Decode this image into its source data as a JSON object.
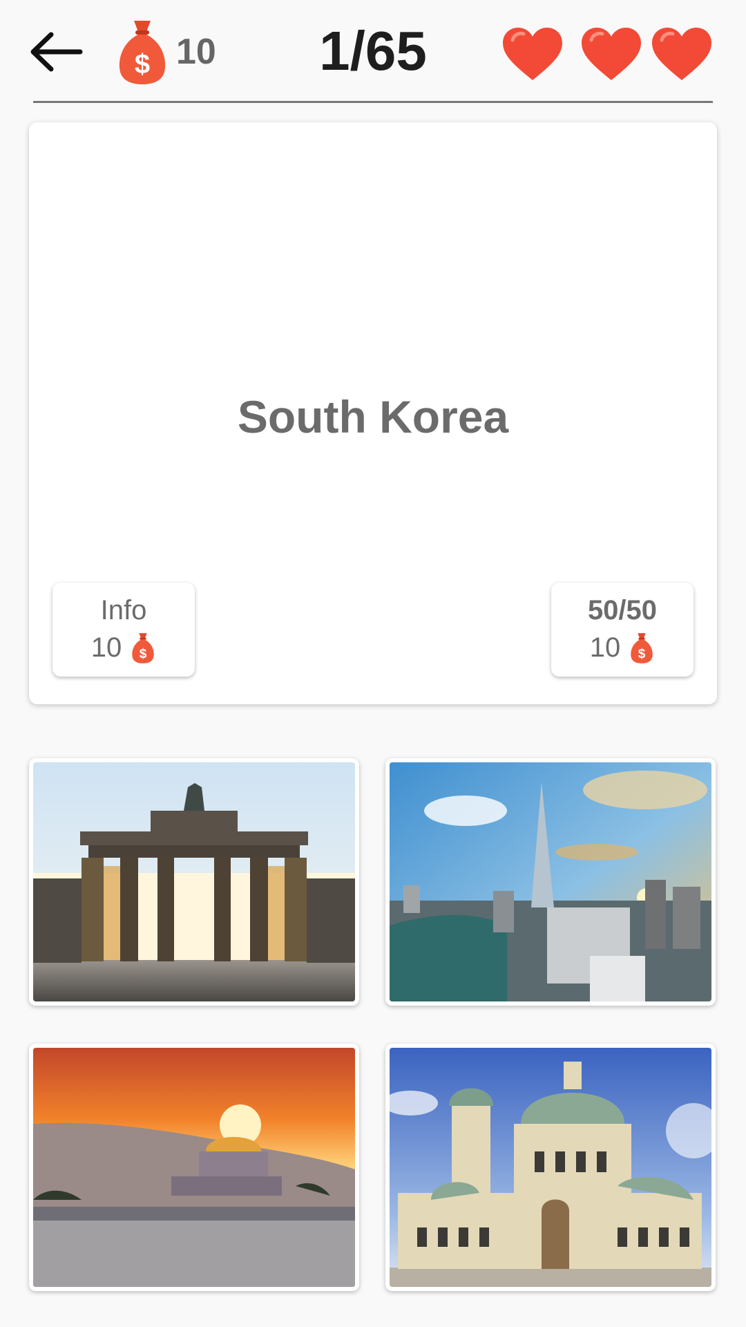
{
  "header": {
    "coins": "10",
    "progress": "1/65",
    "lives": 3
  },
  "question": {
    "country": "South Korea"
  },
  "jokers": {
    "info": {
      "label": "Info",
      "cost": "10"
    },
    "fifty": {
      "label": "50/50",
      "cost": "10"
    }
  },
  "answers": [
    {
      "subject": "brandenburg-gate"
    },
    {
      "subject": "seoul-skyline-tower"
    },
    {
      "subject": "jerusalem-dome-sunset"
    },
    {
      "subject": "alexander-nevsky-cathedral"
    }
  ],
  "colors": {
    "heart": "#f24a36",
    "moneybag": "#f05a3a",
    "text_dark": "#1e1e1e",
    "text_gray": "#6b6b6b"
  }
}
